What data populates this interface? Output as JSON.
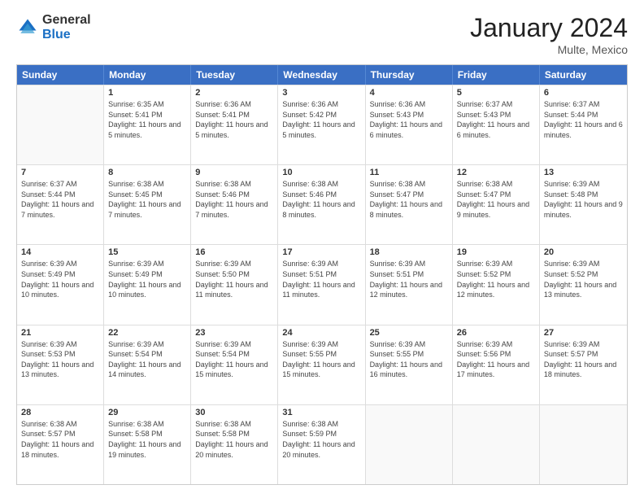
{
  "logo": {
    "general": "General",
    "blue": "Blue"
  },
  "header": {
    "month": "January 2024",
    "location": "Multe, Mexico"
  },
  "weekdays": [
    "Sunday",
    "Monday",
    "Tuesday",
    "Wednesday",
    "Thursday",
    "Friday",
    "Saturday"
  ],
  "rows": [
    [
      {
        "day": "",
        "sunrise": "",
        "sunset": "",
        "daylight": ""
      },
      {
        "day": "1",
        "sunrise": "Sunrise: 6:35 AM",
        "sunset": "Sunset: 5:41 PM",
        "daylight": "Daylight: 11 hours and 5 minutes."
      },
      {
        "day": "2",
        "sunrise": "Sunrise: 6:36 AM",
        "sunset": "Sunset: 5:41 PM",
        "daylight": "Daylight: 11 hours and 5 minutes."
      },
      {
        "day": "3",
        "sunrise": "Sunrise: 6:36 AM",
        "sunset": "Sunset: 5:42 PM",
        "daylight": "Daylight: 11 hours and 5 minutes."
      },
      {
        "day": "4",
        "sunrise": "Sunrise: 6:36 AM",
        "sunset": "Sunset: 5:43 PM",
        "daylight": "Daylight: 11 hours and 6 minutes."
      },
      {
        "day": "5",
        "sunrise": "Sunrise: 6:37 AM",
        "sunset": "Sunset: 5:43 PM",
        "daylight": "Daylight: 11 hours and 6 minutes."
      },
      {
        "day": "6",
        "sunrise": "Sunrise: 6:37 AM",
        "sunset": "Sunset: 5:44 PM",
        "daylight": "Daylight: 11 hours and 6 minutes."
      }
    ],
    [
      {
        "day": "7",
        "sunrise": "Sunrise: 6:37 AM",
        "sunset": "Sunset: 5:44 PM",
        "daylight": "Daylight: 11 hours and 7 minutes."
      },
      {
        "day": "8",
        "sunrise": "Sunrise: 6:38 AM",
        "sunset": "Sunset: 5:45 PM",
        "daylight": "Daylight: 11 hours and 7 minutes."
      },
      {
        "day": "9",
        "sunrise": "Sunrise: 6:38 AM",
        "sunset": "Sunset: 5:46 PM",
        "daylight": "Daylight: 11 hours and 7 minutes."
      },
      {
        "day": "10",
        "sunrise": "Sunrise: 6:38 AM",
        "sunset": "Sunset: 5:46 PM",
        "daylight": "Daylight: 11 hours and 8 minutes."
      },
      {
        "day": "11",
        "sunrise": "Sunrise: 6:38 AM",
        "sunset": "Sunset: 5:47 PM",
        "daylight": "Daylight: 11 hours and 8 minutes."
      },
      {
        "day": "12",
        "sunrise": "Sunrise: 6:38 AM",
        "sunset": "Sunset: 5:47 PM",
        "daylight": "Daylight: 11 hours and 9 minutes."
      },
      {
        "day": "13",
        "sunrise": "Sunrise: 6:39 AM",
        "sunset": "Sunset: 5:48 PM",
        "daylight": "Daylight: 11 hours and 9 minutes."
      }
    ],
    [
      {
        "day": "14",
        "sunrise": "Sunrise: 6:39 AM",
        "sunset": "Sunset: 5:49 PM",
        "daylight": "Daylight: 11 hours and 10 minutes."
      },
      {
        "day": "15",
        "sunrise": "Sunrise: 6:39 AM",
        "sunset": "Sunset: 5:49 PM",
        "daylight": "Daylight: 11 hours and 10 minutes."
      },
      {
        "day": "16",
        "sunrise": "Sunrise: 6:39 AM",
        "sunset": "Sunset: 5:50 PM",
        "daylight": "Daylight: 11 hours and 11 minutes."
      },
      {
        "day": "17",
        "sunrise": "Sunrise: 6:39 AM",
        "sunset": "Sunset: 5:51 PM",
        "daylight": "Daylight: 11 hours and 11 minutes."
      },
      {
        "day": "18",
        "sunrise": "Sunrise: 6:39 AM",
        "sunset": "Sunset: 5:51 PM",
        "daylight": "Daylight: 11 hours and 12 minutes."
      },
      {
        "day": "19",
        "sunrise": "Sunrise: 6:39 AM",
        "sunset": "Sunset: 5:52 PM",
        "daylight": "Daylight: 11 hours and 12 minutes."
      },
      {
        "day": "20",
        "sunrise": "Sunrise: 6:39 AM",
        "sunset": "Sunset: 5:52 PM",
        "daylight": "Daylight: 11 hours and 13 minutes."
      }
    ],
    [
      {
        "day": "21",
        "sunrise": "Sunrise: 6:39 AM",
        "sunset": "Sunset: 5:53 PM",
        "daylight": "Daylight: 11 hours and 13 minutes."
      },
      {
        "day": "22",
        "sunrise": "Sunrise: 6:39 AM",
        "sunset": "Sunset: 5:54 PM",
        "daylight": "Daylight: 11 hours and 14 minutes."
      },
      {
        "day": "23",
        "sunrise": "Sunrise: 6:39 AM",
        "sunset": "Sunset: 5:54 PM",
        "daylight": "Daylight: 11 hours and 15 minutes."
      },
      {
        "day": "24",
        "sunrise": "Sunrise: 6:39 AM",
        "sunset": "Sunset: 5:55 PM",
        "daylight": "Daylight: 11 hours and 15 minutes."
      },
      {
        "day": "25",
        "sunrise": "Sunrise: 6:39 AM",
        "sunset": "Sunset: 5:55 PM",
        "daylight": "Daylight: 11 hours and 16 minutes."
      },
      {
        "day": "26",
        "sunrise": "Sunrise: 6:39 AM",
        "sunset": "Sunset: 5:56 PM",
        "daylight": "Daylight: 11 hours and 17 minutes."
      },
      {
        "day": "27",
        "sunrise": "Sunrise: 6:39 AM",
        "sunset": "Sunset: 5:57 PM",
        "daylight": "Daylight: 11 hours and 18 minutes."
      }
    ],
    [
      {
        "day": "28",
        "sunrise": "Sunrise: 6:38 AM",
        "sunset": "Sunset: 5:57 PM",
        "daylight": "Daylight: 11 hours and 18 minutes."
      },
      {
        "day": "29",
        "sunrise": "Sunrise: 6:38 AM",
        "sunset": "Sunset: 5:58 PM",
        "daylight": "Daylight: 11 hours and 19 minutes."
      },
      {
        "day": "30",
        "sunrise": "Sunrise: 6:38 AM",
        "sunset": "Sunset: 5:58 PM",
        "daylight": "Daylight: 11 hours and 20 minutes."
      },
      {
        "day": "31",
        "sunrise": "Sunrise: 6:38 AM",
        "sunset": "Sunset: 5:59 PM",
        "daylight": "Daylight: 11 hours and 20 minutes."
      },
      {
        "day": "",
        "sunrise": "",
        "sunset": "",
        "daylight": ""
      },
      {
        "day": "",
        "sunrise": "",
        "sunset": "",
        "daylight": ""
      },
      {
        "day": "",
        "sunrise": "",
        "sunset": "",
        "daylight": ""
      }
    ]
  ]
}
